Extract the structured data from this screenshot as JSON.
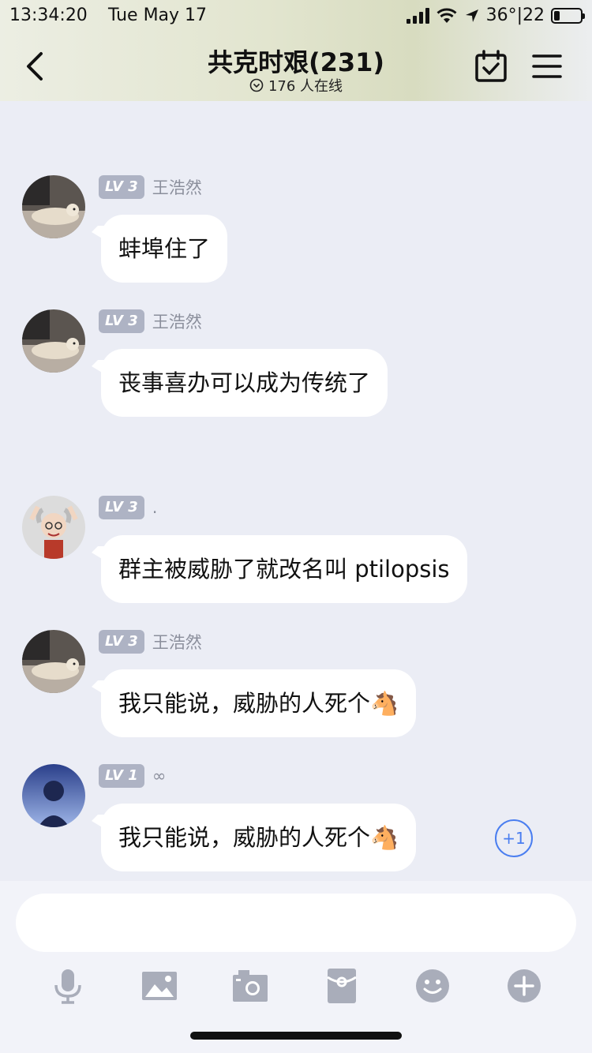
{
  "status_bar": {
    "time": "13:34:20",
    "date": "Tue May 17",
    "battery_text": "36°|22"
  },
  "nav": {
    "title": "共克时艰(231)",
    "online_text": "176 人在线"
  },
  "messages": [
    {
      "level": "LV 3",
      "sender": "王浩然",
      "text": "蚌埠住了",
      "avatar": "seal-photo"
    },
    {
      "level": "LV 3",
      "sender": "王浩然",
      "text": "丧事喜办可以成为传统了",
      "avatar": "seal-photo"
    },
    {
      "level": "LV 3",
      "sender": ".",
      "text": "群主被威胁了就改名叫 ptilopsis",
      "avatar": "cartoon-old-man"
    },
    {
      "level": "LV 3",
      "sender": "王浩然",
      "text": "我只能说，威胁的人死个🐴",
      "avatar": "seal-photo"
    },
    {
      "level": "LV 1",
      "sender": "∞",
      "text": "我只能说，威胁的人死个🐴",
      "avatar": "anime-boy",
      "plus_one": "+1"
    }
  ],
  "input": {
    "placeholder": ""
  },
  "toolbar": [
    "mic-icon",
    "image-icon",
    "camera-icon",
    "red-packet-icon",
    "emoji-icon",
    "plus-icon"
  ],
  "colors": {
    "accent": "#4a7ef0",
    "level_badge": "#aeb3c4",
    "background": "#ebedf5",
    "icon_gray": "#a9adba"
  }
}
